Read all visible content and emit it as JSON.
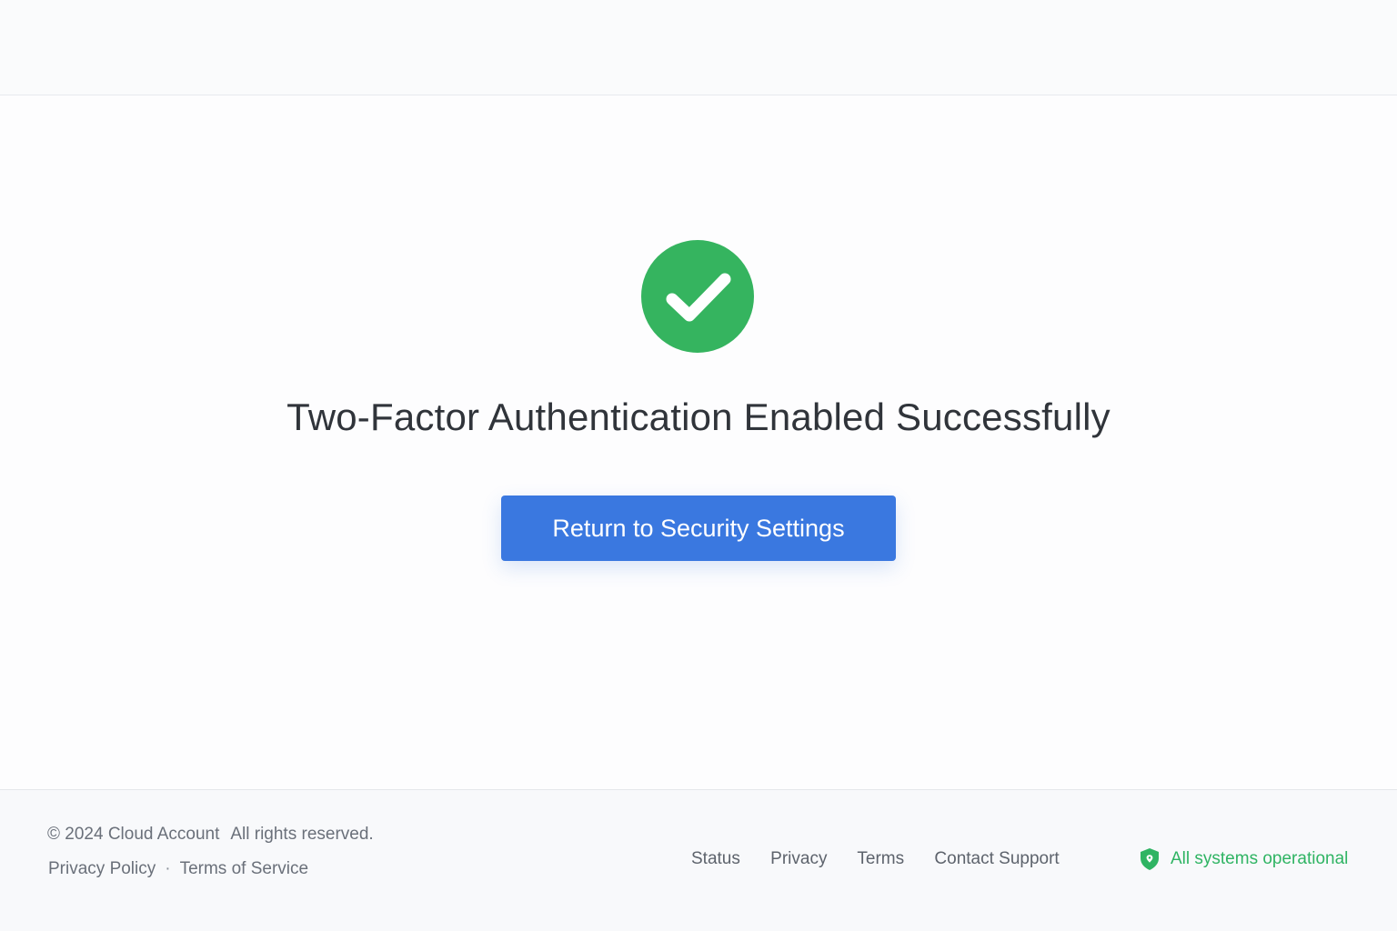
{
  "main": {
    "icon": "check-circle-icon",
    "title": "Two-Factor Authentication Enabled Successfully",
    "button_label": "Return to Security Settings"
  },
  "footer": {
    "copyright_owner": "© 2024 Cloud Account",
    "copyright_rights": "All rights reserved.",
    "legal_links": [
      "Privacy Policy",
      "Terms of Service"
    ],
    "nav_links": [
      "Status",
      "Privacy",
      "Terms",
      "Contact Support"
    ],
    "status_icon": "shield-icon",
    "status_text": "All systems operational"
  },
  "colors": {
    "success": "#35b45f",
    "primary": "#3a78e0",
    "status": "#2fb463"
  }
}
